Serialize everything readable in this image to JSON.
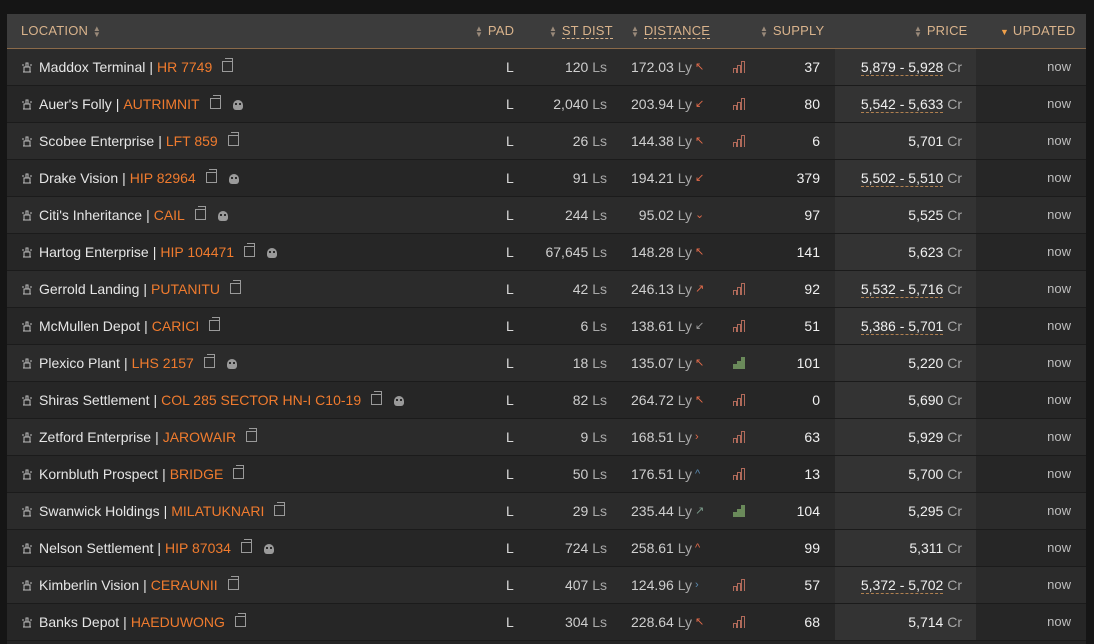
{
  "columns": {
    "location": "LOCATION",
    "pad": "PAD",
    "st_dist": "ST DIST",
    "distance": "DISTANCE",
    "supply": "SUPPLY",
    "price": "PRICE",
    "updated": "UPDATED"
  },
  "rows": [
    {
      "station": "Maddox Terminal",
      "system": "HR 7749",
      "skull": false,
      "pad": "L",
      "st_dist": "120",
      "distance": "172.03",
      "dir": "↖",
      "dir_color": "#e06a4a",
      "bar": true,
      "bar_green": false,
      "supply": "37",
      "price": "5,879 - 5,928",
      "price_range": true,
      "updated": "now"
    },
    {
      "station": "Auer's Folly",
      "system": "AUTRIMNIT",
      "skull": true,
      "pad": "L",
      "st_dist": "2,040",
      "distance": "203.94",
      "dir": "↙",
      "dir_color": "#e06a4a",
      "bar": true,
      "bar_green": false,
      "supply": "80",
      "price": "5,542 - 5,633",
      "price_range": true,
      "updated": "now"
    },
    {
      "station": "Scobee Enterprise",
      "system": "LFT 859",
      "skull": false,
      "pad": "L",
      "st_dist": "26",
      "distance": "144.38",
      "dir": "↖",
      "dir_color": "#e06a4a",
      "bar": true,
      "bar_green": false,
      "supply": "6",
      "price": "5,701",
      "price_range": false,
      "updated": "now"
    },
    {
      "station": "Drake Vision",
      "system": "HIP 82964",
      "skull": true,
      "pad": "L",
      "st_dist": "91",
      "distance": "194.21",
      "dir": "↙",
      "dir_color": "#e06a4a",
      "bar": false,
      "bar_green": false,
      "supply": "379",
      "price": "5,502 - 5,510",
      "price_range": true,
      "updated": "now"
    },
    {
      "station": "Citi's Inheritance",
      "system": "CAIL",
      "skull": true,
      "pad": "L",
      "st_dist": "244",
      "distance": "95.02",
      "dir": "⌄",
      "dir_color": "#e06a4a",
      "bar": false,
      "bar_green": false,
      "supply": "97",
      "price": "5,525",
      "price_range": false,
      "updated": "now"
    },
    {
      "station": "Hartog Enterprise",
      "system": "HIP 104471",
      "skull": true,
      "pad": "L",
      "st_dist": "67,645",
      "distance": "148.28",
      "dir": "↖",
      "dir_color": "#e06a4a",
      "bar": false,
      "bar_green": false,
      "supply": "141",
      "price": "5,623",
      "price_range": false,
      "updated": "now"
    },
    {
      "station": "Gerrold Landing",
      "system": "PUTANITU",
      "skull": false,
      "pad": "L",
      "st_dist": "42",
      "distance": "246.13",
      "dir": "↗",
      "dir_color": "#e06a4a",
      "bar": true,
      "bar_green": false,
      "supply": "92",
      "price": "5,532 - 5,716",
      "price_range": true,
      "updated": "now"
    },
    {
      "station": "McMullen Depot",
      "system": "CARICI",
      "skull": false,
      "pad": "L",
      "st_dist": "6",
      "distance": "138.61",
      "dir": "↙",
      "dir_color": "#9a9a9a",
      "bar": true,
      "bar_green": false,
      "supply": "51",
      "price": "5,386 - 5,701",
      "price_range": true,
      "updated": "now"
    },
    {
      "station": "Plexico Plant",
      "system": "LHS 2157",
      "skull": true,
      "pad": "L",
      "st_dist": "18",
      "distance": "135.07",
      "dir": "↖",
      "dir_color": "#e06a4a",
      "bar": true,
      "bar_green": true,
      "supply": "101",
      "price": "5,220",
      "price_range": false,
      "updated": "now"
    },
    {
      "station": "Shiras Settlement",
      "system": "COL 285 SECTOR HN-I C10-19",
      "skull": true,
      "pad": "L",
      "st_dist": "82",
      "distance": "264.72",
      "dir": "↖",
      "dir_color": "#e06a4a",
      "bar": true,
      "bar_green": false,
      "supply": "0",
      "price": "5,690",
      "price_range": false,
      "updated": "now"
    },
    {
      "station": "Zetford Enterprise",
      "system": "JAROWAIR",
      "skull": false,
      "pad": "L",
      "st_dist": "9",
      "distance": "168.51",
      "dir": "›",
      "dir_color": "#e06a4a",
      "bar": true,
      "bar_green": false,
      "supply": "63",
      "price": "5,929",
      "price_range": false,
      "updated": "now"
    },
    {
      "station": "Kornbluth Prospect",
      "system": "BRIDGE",
      "skull": false,
      "pad": "L",
      "st_dist": "50",
      "distance": "176.51",
      "dir": "^",
      "dir_color": "#5a8ab0",
      "bar": true,
      "bar_green": false,
      "supply": "13",
      "price": "5,700",
      "price_range": false,
      "updated": "now"
    },
    {
      "station": "Swanwick Holdings",
      "system": "MILATUKNARI",
      "skull": false,
      "pad": "L",
      "st_dist": "29",
      "distance": "235.44",
      "dir": "↗",
      "dir_color": "#7a9a8a",
      "bar": true,
      "bar_green": true,
      "supply": "104",
      "price": "5,295",
      "price_range": false,
      "updated": "now"
    },
    {
      "station": "Nelson Settlement",
      "system": "HIP 87034",
      "skull": true,
      "pad": "L",
      "st_dist": "724",
      "distance": "258.61",
      "dir": "^",
      "dir_color": "#e06a4a",
      "bar": false,
      "bar_green": false,
      "supply": "99",
      "price": "5,311",
      "price_range": false,
      "updated": "now"
    },
    {
      "station": "Kimberlin Vision",
      "system": "CERAUNII",
      "skull": false,
      "pad": "L",
      "st_dist": "407",
      "distance": "124.96",
      "dir": "›",
      "dir_color": "#5a8ab0",
      "bar": true,
      "bar_green": false,
      "supply": "57",
      "price": "5,372 - 5,702",
      "price_range": true,
      "updated": "now"
    },
    {
      "station": "Banks Depot",
      "system": "HAEDUWONG",
      "skull": false,
      "pad": "L",
      "st_dist": "304",
      "distance": "228.64",
      "dir": "↖",
      "dir_color": "#e06a4a",
      "bar": true,
      "bar_green": false,
      "supply": "68",
      "price": "5,714",
      "price_range": false,
      "updated": "now"
    }
  ],
  "units": {
    "st_dist": "Ls",
    "distance": "Ly",
    "price": "Cr"
  },
  "icons": {
    "station": "station-icon",
    "copy": "copy-icon",
    "skull": "skull-icon",
    "bar": "demand-bar-icon"
  },
  "colors": {
    "system": "#f07b2e",
    "header_text": "#d9b38c",
    "sort_active": "#f0a04a"
  }
}
